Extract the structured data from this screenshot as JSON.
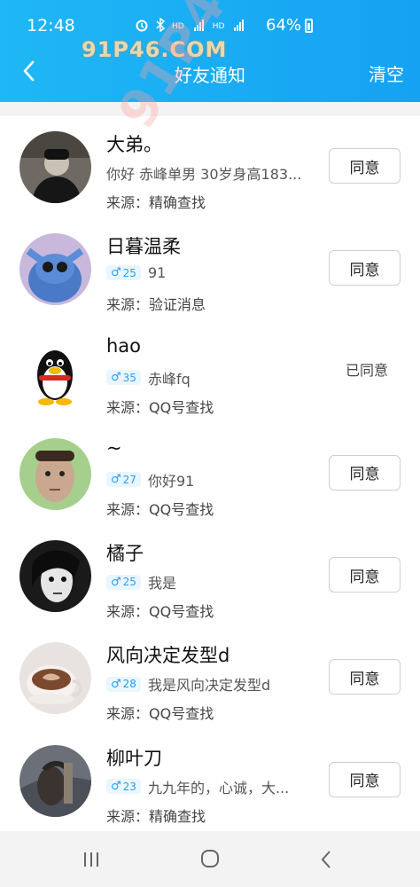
{
  "status_bar": {
    "time": "12:48",
    "icons": [
      "alarm-icon",
      "bluetooth-icon",
      "hd-icon",
      "4g-signal-icon",
      "hd-icon",
      "4g-signal-icon"
    ],
    "battery": "64%"
  },
  "watermark": {
    "top_text": "91P46.COM",
    "diagonal_text": "91P46.COM"
  },
  "header": {
    "title": "好友通知",
    "clear_label": "清空",
    "back_icon": "chevron-left-icon"
  },
  "colors": {
    "header": "#15a2f2",
    "accent": "#2b9df0"
  },
  "notifications": [
    {
      "name": "大弟。",
      "gender": "",
      "age": "",
      "message": "你好 赤峰单男 30岁身高183...",
      "source": "来源：精确查找",
      "action": "同意",
      "status": "pending"
    },
    {
      "name": "日暮温柔",
      "gender": "♂",
      "age": "25",
      "message": "91",
      "source": "来源：验证消息",
      "action": "同意",
      "status": "pending"
    },
    {
      "name": "hao",
      "gender": "♂",
      "age": "35",
      "message": "赤峰fq",
      "source": "来源：QQ号查找",
      "action": "已同意",
      "status": "agreed"
    },
    {
      "name": "~",
      "gender": "♂",
      "age": "27",
      "message": "你好91",
      "source": "来源：QQ号查找",
      "action": "同意",
      "status": "pending"
    },
    {
      "name": "橘子",
      "gender": "♂",
      "age": "25",
      "message": "我是",
      "source": "来源：QQ号查找",
      "action": "同意",
      "status": "pending"
    },
    {
      "name": "风向决定发型d",
      "gender": "♂",
      "age": "28",
      "message": "我是风向决定发型d",
      "source": "来源：QQ号查找",
      "action": "同意",
      "status": "pending"
    },
    {
      "name": "柳叶刀",
      "gender": "♂",
      "age": "23",
      "message": "九九年的，心诚，大...",
      "source": "来源：精确查找",
      "action": "同意",
      "status": "pending"
    }
  ],
  "bottom_nav": {
    "icons": [
      "recent-apps-icon",
      "home-icon",
      "back-icon"
    ]
  }
}
